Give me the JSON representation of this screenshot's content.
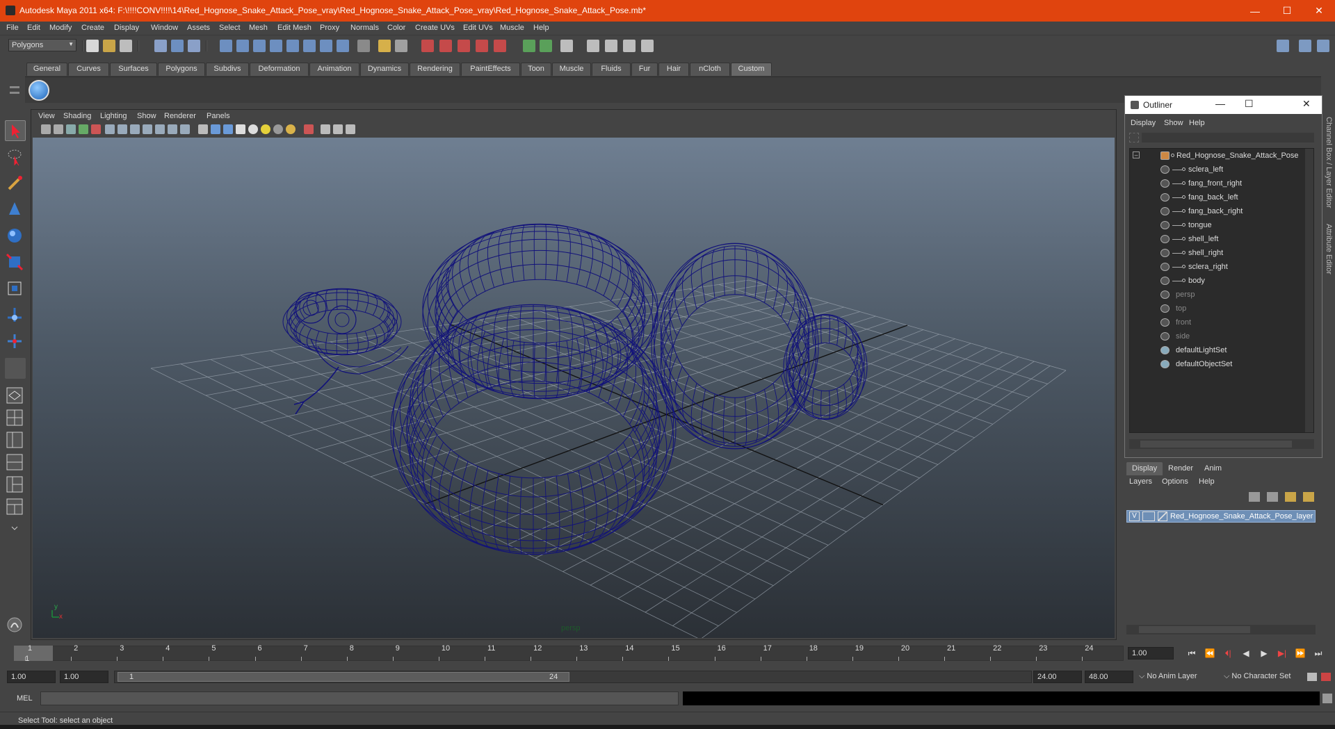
{
  "window": {
    "title": "Autodesk Maya 2011 x64: F:\\!!!!CONV!!!!\\14\\Red_Hognose_Snake_Attack_Pose_vray\\Red_Hognose_Snake_Attack_Pose_vray\\Red_Hognose_Snake_Attack_Pose.mb*"
  },
  "menubar": [
    "File",
    "Edit",
    "Modify",
    "Create",
    "Display",
    "Window",
    "Assets",
    "Select",
    "Mesh",
    "Edit Mesh",
    "Proxy",
    "Normals",
    "Color",
    "Create UVs",
    "Edit UVs",
    "Muscle",
    "Help"
  ],
  "toolbar": {
    "mode": "Polygons"
  },
  "shelf_tabs": [
    "General",
    "Curves",
    "Surfaces",
    "Polygons",
    "Subdivs",
    "Deformation",
    "Animation",
    "Dynamics",
    "Rendering",
    "PaintEffects",
    "Toon",
    "Muscle",
    "Fluids",
    "Fur",
    "Hair",
    "nCloth",
    "Custom"
  ],
  "shelf_active": "Custom",
  "viewport": {
    "menu": [
      "View",
      "Shading",
      "Lighting",
      "Show",
      "Renderer",
      "Panels"
    ],
    "camera_label": "persp",
    "axis_y": "y",
    "axis_x": "x"
  },
  "outliner": {
    "title": "Outliner",
    "menu": [
      "Display",
      "Show",
      "Help"
    ],
    "root": "Red_Hognose_Snake_Attack_Pose",
    "children": [
      "sclera_left",
      "fang_front_right",
      "fang_back_left",
      "fang_back_right",
      "tongue",
      "shell_left",
      "shell_right",
      "sclera_right",
      "body"
    ],
    "cameras": [
      "persp",
      "top",
      "front",
      "side"
    ],
    "sets": [
      "defaultLightSet",
      "defaultObjectSet"
    ]
  },
  "layer_editor": {
    "tabs": [
      "Display",
      "Render",
      "Anim"
    ],
    "active_tab": "Display",
    "menu": [
      "Layers",
      "Options",
      "Help"
    ],
    "layer_visible": "V",
    "layer_name": "Red_Hognose_Snake_Attack_Pose_layer"
  },
  "side_tabs": [
    "Channel Box / Layer Editor",
    "Attribute Editor"
  ],
  "timeline": {
    "ticks": [
      "1",
      "2",
      "3",
      "4",
      "5",
      "6",
      "7",
      "8",
      "9",
      "10",
      "11",
      "12",
      "13",
      "14",
      "15",
      "16",
      "17",
      "18",
      "19",
      "20",
      "21",
      "22",
      "23",
      "24"
    ],
    "current_frame": "1",
    "current_field": "1.00"
  },
  "playback": {
    "buttons": [
      "⏮",
      "⏪",
      "⏴|",
      "◀",
      "▶",
      "▶|",
      "⏩",
      "⏭"
    ]
  },
  "range": {
    "start": "1.00",
    "playback_start": "1.00",
    "slider_start": "1",
    "slider_end": "24",
    "playback_end": "24.00",
    "end": "48.00",
    "anim_layer": "No Anim Layer",
    "character_set": "No Character Set"
  },
  "command": {
    "label": "MEL"
  },
  "status": {
    "text": "Select Tool: select an object"
  },
  "colors": {
    "titlebar": "#e0440e",
    "wire": "#12127a",
    "layer_highlight": "#6e8fb6"
  }
}
